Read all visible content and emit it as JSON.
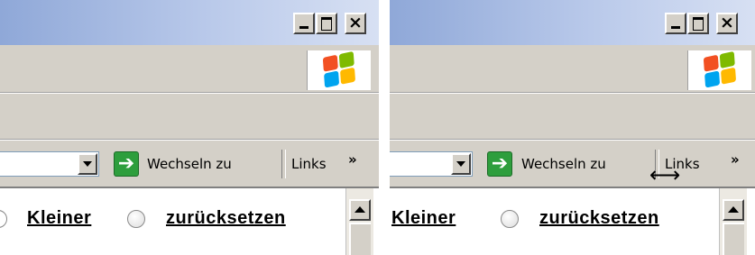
{
  "window_controls": {
    "minimize_label": "_",
    "maximize_label": "",
    "close_label": "×"
  },
  "address_bar": {
    "go_label": "Wechseln zu",
    "go_arrow": "➔",
    "links_label": "Links",
    "chevron": "»"
  },
  "content": {
    "smaller_label": "Kleiner",
    "reset_label": "zurücksetzen"
  },
  "cursor": {
    "resize_glyph": "⟷"
  },
  "colors": {
    "titlebar_start": "#8fa8d8",
    "titlebar_end": "#d7e0f3",
    "chrome": "#d4d0c8",
    "go_green": "#2e9e3d"
  },
  "icons": [
    "minimize-icon",
    "maximize-icon",
    "close-icon",
    "windows-logo-icon",
    "dropdown-arrow-icon",
    "go-arrow-icon",
    "chevron-icon",
    "scroll-up-icon",
    "resize-cursor-icon"
  ]
}
